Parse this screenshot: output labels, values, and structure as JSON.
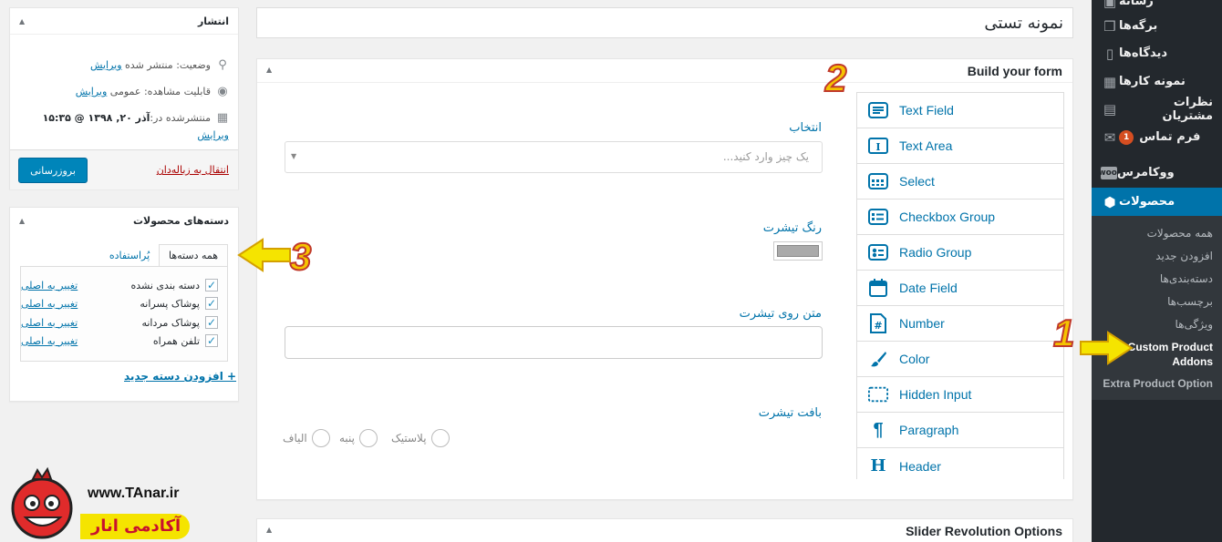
{
  "sidebar": {
    "items": [
      {
        "label": "رسانه",
        "icon": "media-icon"
      },
      {
        "label": "برگه‌ها",
        "icon": "page-icon"
      },
      {
        "label": "دیدگاه‌ها",
        "icon": "comment-icon"
      },
      {
        "label": "نمونه کارها",
        "icon": "portfolio-icon"
      },
      {
        "label": "نظرات مشتریان",
        "icon": "testimonial-icon"
      },
      {
        "label": "فرم تماس",
        "icon": "mail-icon",
        "badge": "1"
      },
      {
        "label": "ووکامرس",
        "icon": "woo-icon"
      },
      {
        "label": "محصولات",
        "icon": "product-icon",
        "active": true
      }
    ],
    "submenu": [
      "همه محصولات",
      "افزودن جدید",
      "دسته‌بندی‌ها",
      "برچسب‌ها",
      "ویژگی‌ها",
      "Custom Product Addons",
      "Extra Product Option"
    ],
    "accent": "#0073aa",
    "bg": "#23282d"
  },
  "title_value": "نمونه تستی",
  "form_builder": {
    "title": "Build your form",
    "fields": [
      {
        "label": "انتخاب",
        "type": "select",
        "placeholder": "یک چیز وارد کنید..."
      },
      {
        "label": "رنگ تیشرت",
        "type": "color"
      },
      {
        "label": "متن روی تیشرت",
        "type": "text"
      },
      {
        "label": "بافت تیشرت",
        "type": "radio",
        "options": [
          "پلاستیک",
          "پنبه",
          "الیاف"
        ]
      }
    ],
    "buttons": [
      {
        "label": "Text Field",
        "icon": "text-field-icon"
      },
      {
        "label": "Text Area",
        "icon": "text-area-icon"
      },
      {
        "label": "Select",
        "icon": "select-icon"
      },
      {
        "label": "Checkbox Group",
        "icon": "checkbox-group-icon"
      },
      {
        "label": "Radio Group",
        "icon": "radio-group-icon"
      },
      {
        "label": "Date Field",
        "icon": "calendar-icon"
      },
      {
        "label": "Number",
        "icon": "number-icon"
      },
      {
        "label": "Color",
        "icon": "brush-icon"
      },
      {
        "label": "Hidden Input",
        "icon": "hidden-input-icon"
      },
      {
        "label": "Paragraph",
        "icon": "paragraph-icon"
      },
      {
        "label": "Header",
        "icon": "header-icon"
      }
    ]
  },
  "slider_box": {
    "title": "Slider Revolution Options"
  },
  "publish": {
    "title": "انتشار",
    "status_label": "وضعیت:",
    "status_value": "منتشر شده",
    "visibility_label": "قابلیت مشاهده:",
    "visibility_value": "عمومی",
    "published_label": "منتشرشده در:",
    "published_value": "آذر ۲۰, ۱۳۹۸ @ ۱۵:۳۵",
    "edit_label": "ویرایش",
    "trash_label": "انتقال به زباله‌دان",
    "update_label": "بروزرسانی"
  },
  "categories": {
    "title": "دسته‌های محصولات",
    "tab_all": "همه دسته‌ها",
    "tab_popular": "پُراستفاده",
    "make_primary": "تغییر به اصلی",
    "items": [
      {
        "name": "دسته بندی نشده",
        "checked": true
      },
      {
        "name": "پوشاک پسرانه",
        "checked": true
      },
      {
        "name": "پوشاک مردانه",
        "checked": true
      },
      {
        "name": "تلفن همراه",
        "checked": true
      }
    ],
    "add_new": "+ افزودن دسته جدید"
  },
  "annotations": {
    "one": "1",
    "two": "2",
    "three": "3"
  },
  "watermark": {
    "url": "www.TAnar.ir",
    "name": "آکادمی انار"
  }
}
